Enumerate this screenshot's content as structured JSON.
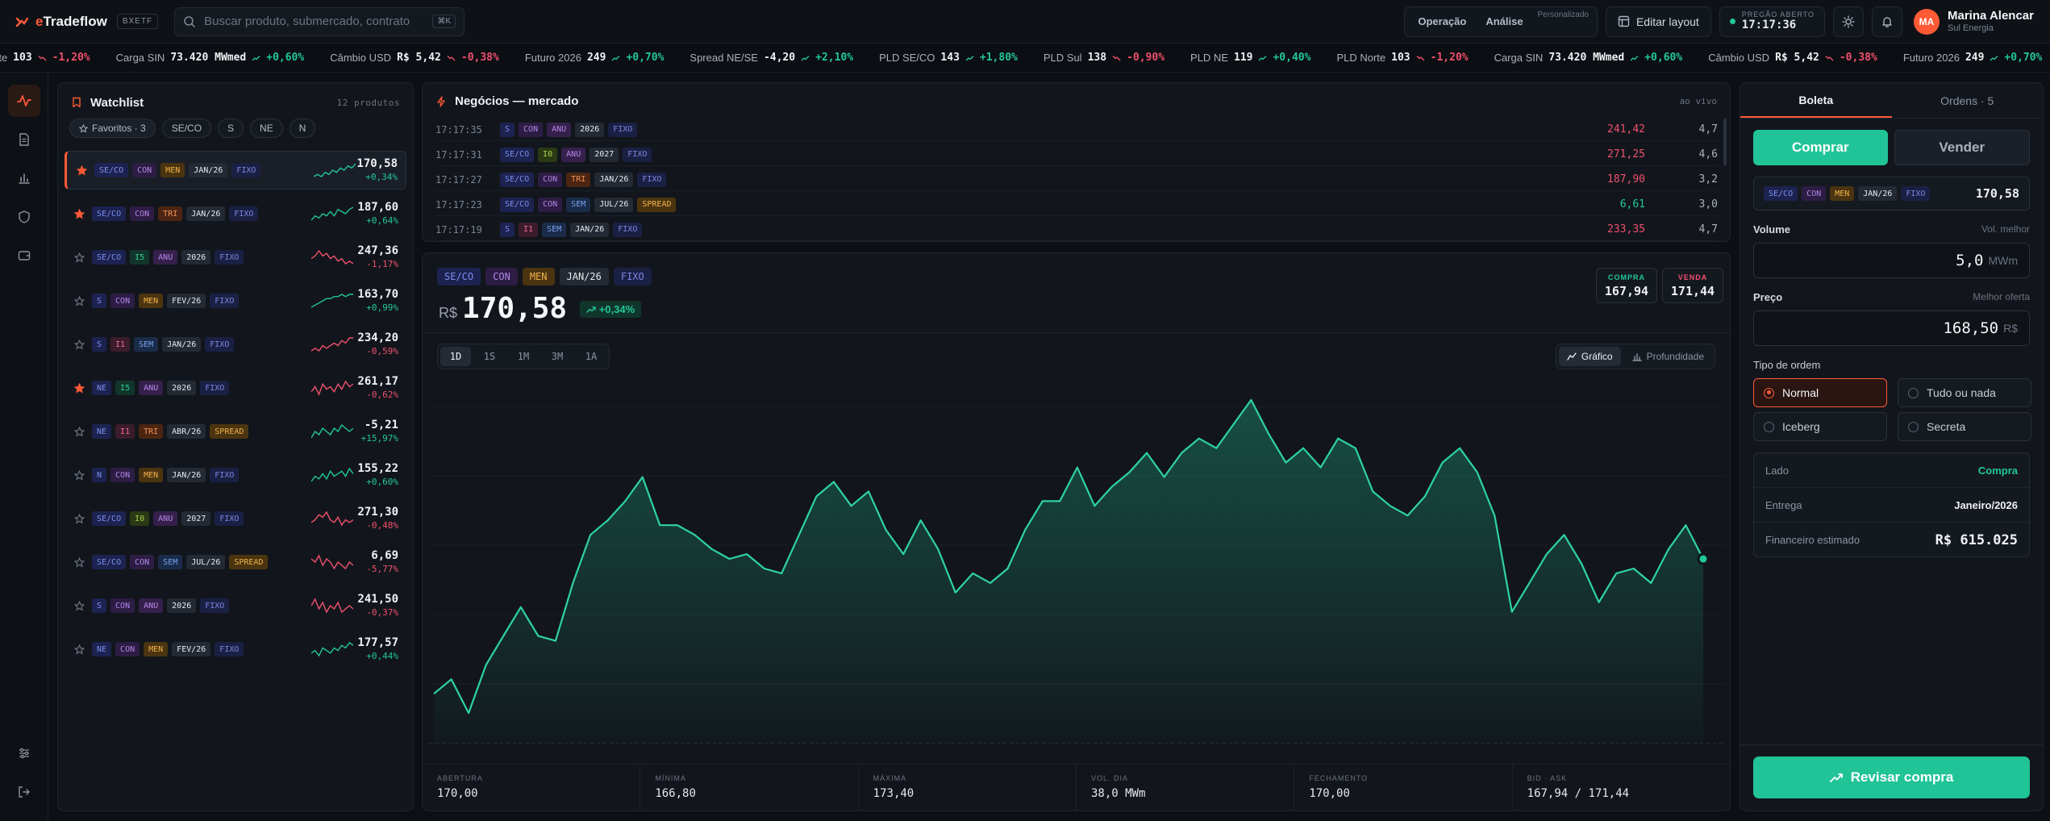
{
  "brand": {
    "name_prefix": "e",
    "name_rest": "Tradeflow",
    "env": "BXETF"
  },
  "search": {
    "placeholder": "Buscar produto, submercado, contrato",
    "shortcut": "⌘K"
  },
  "header": {
    "modes": [
      "Operação",
      "Análise"
    ],
    "custom_label": "Personalizado",
    "edit_layout": "Editar layout",
    "market_status": "PREGÃO ABERTO",
    "clock": "17:17:36",
    "user_initials": "MA",
    "user_name": "Marina Alencar",
    "user_company": "Sul Energia"
  },
  "ticker": [
    {
      "name": "rte",
      "value": "103",
      "change": "-1,20%",
      "dir": "down"
    },
    {
      "name": "Carga SIN",
      "value": "73.420 MWmed",
      "change": "+0,60%",
      "dir": "up"
    },
    {
      "name": "Câmbio USD",
      "value": "R$ 5,42",
      "change": "-0,38%",
      "dir": "down"
    },
    {
      "name": "Futuro 2026",
      "value": "249",
      "change": "+0,70%",
      "dir": "up"
    },
    {
      "name": "Spread NE/SE",
      "value": "-4,20",
      "change": "+2,10%",
      "dir": "up"
    },
    {
      "name": "PLD SE/CO",
      "value": "143",
      "change": "+1,80%",
      "dir": "up"
    },
    {
      "name": "PLD Sul",
      "value": "138",
      "change": "-0,90%",
      "dir": "down"
    },
    {
      "name": "PLD NE",
      "value": "119",
      "change": "+0,40%",
      "dir": "up"
    },
    {
      "name": "PLD Norte",
      "value": "103",
      "change": "-1,20%",
      "dir": "down"
    },
    {
      "name": "Carga SIN",
      "value": "73.420 MWmed",
      "change": "+0,60%",
      "dir": "up"
    },
    {
      "name": "Câmbio USD",
      "value": "R$ 5,42",
      "change": "-0,38%",
      "dir": "down"
    },
    {
      "name": "Futuro 2026",
      "value": "249",
      "change": "+0,70%",
      "dir": "up"
    },
    {
      "name": "Spread NE/SE",
      "value": "",
      "change": "",
      "dir": "up"
    }
  ],
  "watchlist": {
    "title": "Watchlist",
    "count": "12 produtos",
    "filters": [
      "Favoritos · 3",
      "SE/CO",
      "S",
      "NE",
      "N"
    ],
    "rows": [
      {
        "fav": true,
        "tags": [
          [
            "SE/CO",
            "sub"
          ],
          [
            "CON",
            "con"
          ],
          [
            "MEN",
            "men"
          ],
          [
            "JAN/26",
            "date"
          ],
          [
            "FIXO",
            "fixo"
          ]
        ],
        "price": "170,58",
        "change": "+0,34%",
        "dir": "up",
        "spark": [
          3,
          4,
          3,
          5,
          4,
          6,
          5,
          7,
          6,
          8,
          7,
          9
        ]
      },
      {
        "fav": true,
        "tags": [
          [
            "SE/CO",
            "sub"
          ],
          [
            "CON",
            "con"
          ],
          [
            "TRI",
            "tri"
          ],
          [
            "JAN/26",
            "date"
          ],
          [
            "FIXO",
            "fixo"
          ]
        ],
        "price": "187,60",
        "change": "+0,64%",
        "dir": "up",
        "spark": [
          3,
          5,
          4,
          6,
          5,
          7,
          5,
          8,
          7,
          6,
          8,
          9
        ]
      },
      {
        "fav": false,
        "tags": [
          [
            "SE/CO",
            "sub"
          ],
          [
            "I5",
            "i5"
          ],
          [
            "ANU",
            "anu"
          ],
          [
            "2026",
            "date"
          ],
          [
            "FIXO",
            "fixo"
          ]
        ],
        "price": "247,36",
        "change": "-1,17%",
        "dir": "down",
        "spark": [
          5,
          6,
          8,
          6,
          7,
          5,
          6,
          4,
          5,
          3,
          4,
          3
        ]
      },
      {
        "fav": false,
        "tags": [
          [
            "S",
            "sub"
          ],
          [
            "CON",
            "con"
          ],
          [
            "MEN",
            "men"
          ],
          [
            "FEV/26",
            "date"
          ],
          [
            "FIXO",
            "fixo"
          ]
        ],
        "price": "163,70",
        "change": "+0,99%",
        "dir": "up",
        "spark": [
          2,
          3,
          4,
          5,
          6,
          6,
          7,
          7,
          8,
          7,
          8,
          8
        ]
      },
      {
        "fav": false,
        "tags": [
          [
            "S",
            "sub"
          ],
          [
            "I1",
            "i1"
          ],
          [
            "SEM",
            "sem"
          ],
          [
            "JAN/26",
            "date"
          ],
          [
            "FIXO",
            "fixo"
          ]
        ],
        "price": "234,20",
        "change": "-0,59%",
        "dir": "down",
        "spark": [
          3,
          4,
          3,
          5,
          4,
          5,
          6,
          5,
          7,
          6,
          8,
          8
        ]
      },
      {
        "fav": true,
        "tags": [
          [
            "NE",
            "sub"
          ],
          [
            "I5",
            "i5"
          ],
          [
            "ANU",
            "anu"
          ],
          [
            "2026",
            "date"
          ],
          [
            "FIXO",
            "fixo"
          ]
        ],
        "price": "261,17",
        "change": "-0,62%",
        "dir": "down",
        "spark": [
          4,
          6,
          3,
          7,
          5,
          6,
          4,
          7,
          5,
          8,
          6,
          7
        ]
      },
      {
        "fav": false,
        "tags": [
          [
            "NE",
            "sub"
          ],
          [
            "I1",
            "i1"
          ],
          [
            "TRI",
            "tri"
          ],
          [
            "ABR/26",
            "date"
          ],
          [
            "SPREAD",
            "spread"
          ]
        ],
        "price": "-5,21",
        "change": "+15,97%",
        "dir": "up",
        "spark": [
          5,
          7,
          6,
          8,
          7,
          6,
          8,
          7,
          9,
          8,
          7,
          8
        ]
      },
      {
        "fav": false,
        "tags": [
          [
            "N",
            "sub"
          ],
          [
            "CON",
            "con"
          ],
          [
            "MEN",
            "men"
          ],
          [
            "JAN/26",
            "date"
          ],
          [
            "FIXO",
            "fixo"
          ]
        ],
        "price": "155,22",
        "change": "+0,60%",
        "dir": "up",
        "spark": [
          3,
          5,
          4,
          6,
          4,
          7,
          5,
          6,
          7,
          5,
          8,
          6
        ]
      },
      {
        "fav": false,
        "tags": [
          [
            "SE/CO",
            "sub"
          ],
          [
            "I0",
            "i0"
          ],
          [
            "ANU",
            "anu"
          ],
          [
            "2027",
            "date"
          ],
          [
            "FIXO",
            "fixo"
          ]
        ],
        "price": "271,30",
        "change": "-0,48%",
        "dir": "down",
        "spark": [
          4,
          5,
          7,
          6,
          8,
          5,
          4,
          6,
          3,
          5,
          4,
          5
        ]
      },
      {
        "fav": false,
        "tags": [
          [
            "SE/CO",
            "sub"
          ],
          [
            "CON",
            "con"
          ],
          [
            "SEM",
            "sem"
          ],
          [
            "JUL/26",
            "date"
          ],
          [
            "SPREAD",
            "spread"
          ]
        ],
        "price": "6,69",
        "change": "-5,77%",
        "dir": "down",
        "spark": [
          7,
          6,
          8,
          5,
          7,
          6,
          4,
          6,
          5,
          4,
          6,
          5
        ]
      },
      {
        "fav": false,
        "tags": [
          [
            "S",
            "sub"
          ],
          [
            "CON",
            "con"
          ],
          [
            "ANU",
            "anu"
          ],
          [
            "2026",
            "date"
          ],
          [
            "FIXO",
            "fixo"
          ]
        ],
        "price": "241,50",
        "change": "-0,37%",
        "dir": "down",
        "spark": [
          6,
          8,
          5,
          7,
          4,
          6,
          5,
          7,
          4,
          5,
          6,
          5
        ]
      },
      {
        "fav": false,
        "tags": [
          [
            "NE",
            "sub"
          ],
          [
            "CON",
            "con"
          ],
          [
            "MEN",
            "men"
          ],
          [
            "FEV/26",
            "date"
          ],
          [
            "FIXO",
            "fixo"
          ]
        ],
        "price": "177,57",
        "change": "+0,44%",
        "dir": "up",
        "spark": [
          4,
          5,
          3,
          6,
          5,
          4,
          6,
          5,
          7,
          6,
          8,
          7
        ]
      }
    ]
  },
  "trades": {
    "title": "Negócios — mercado",
    "live": "ao vivo",
    "rows": [
      {
        "time": "17:17:35",
        "tags": [
          [
            "S",
            "sub"
          ],
          [
            "CON",
            "con"
          ],
          [
            "ANU",
            "anu"
          ],
          [
            "2026",
            "date"
          ],
          [
            "FIXO",
            "fixo"
          ]
        ],
        "price": "241,42",
        "dir": "down",
        "vol": "4,7"
      },
      {
        "time": "17:17:31",
        "tags": [
          [
            "SE/CO",
            "sub"
          ],
          [
            "I0",
            "i0"
          ],
          [
            "ANU",
            "anu"
          ],
          [
            "2027",
            "date"
          ],
          [
            "FIXO",
            "fixo"
          ]
        ],
        "price": "271,25",
        "dir": "down",
        "vol": "4,6"
      },
      {
        "time": "17:17:27",
        "tags": [
          [
            "SE/CO",
            "sub"
          ],
          [
            "CON",
            "con"
          ],
          [
            "TRI",
            "tri"
          ],
          [
            "JAN/26",
            "date"
          ],
          [
            "FIXO",
            "fixo"
          ]
        ],
        "price": "187,90",
        "dir": "down",
        "vol": "3,2"
      },
      {
        "time": "17:17:23",
        "tags": [
          [
            "SE/CO",
            "sub"
          ],
          [
            "CON",
            "con"
          ],
          [
            "SEM",
            "sem"
          ],
          [
            "JUL/26",
            "date"
          ],
          [
            "SPREAD",
            "spread"
          ]
        ],
        "price": "6,61",
        "dir": "up",
        "vol": "3,0"
      },
      {
        "time": "17:17:19",
        "tags": [
          [
            "S",
            "sub"
          ],
          [
            "I1",
            "i1"
          ],
          [
            "SEM",
            "sem"
          ],
          [
            "JAN/26",
            "date"
          ],
          [
            "FIXO",
            "fixo"
          ]
        ],
        "price": "233,35",
        "dir": "down",
        "vol": "4,7"
      }
    ]
  },
  "instrument": {
    "tags": [
      [
        "SE/CO",
        "sub"
      ],
      [
        "CON",
        "con"
      ],
      [
        "MEN",
        "men"
      ],
      [
        "JAN/26",
        "date"
      ],
      [
        "FIXO",
        "fixo"
      ]
    ],
    "currency": "R$",
    "price": "170,58",
    "change": "+0,34%",
    "buy_label": "COMPRA",
    "buy": "167,94",
    "sell_label": "VENDA",
    "sell": "171,44"
  },
  "chart": {
    "ranges": [
      "1D",
      "1S",
      "1M",
      "3M",
      "1A"
    ],
    "active_range": "1D",
    "views": [
      "Gráfico",
      "Profundidade"
    ],
    "line_color": "#2fd3a3",
    "stats": [
      {
        "label": "ABERTURA",
        "value": "170,00"
      },
      {
        "label": "MÍNIMA",
        "value": "166,80"
      },
      {
        "label": "MÁXIMA",
        "value": "173,40"
      },
      {
        "label": "VOL. DIA",
        "value": "38,0 MWm"
      },
      {
        "label": "FECHAMENTO",
        "value": "170,00"
      },
      {
        "label": "BID · ASK",
        "value": "167,94 / 171,44"
      }
    ]
  },
  "chart_data": {
    "type": "area",
    "ylim": [
      166.4,
      173.6
    ],
    "values": [
      167.3,
      167.6,
      166.9,
      167.9,
      168.5,
      169.1,
      168.5,
      168.4,
      169.6,
      170.6,
      170.9,
      171.3,
      171.8,
      170.8,
      170.8,
      170.6,
      170.3,
      170.1,
      170.2,
      169.9,
      169.8,
      170.6,
      171.4,
      171.7,
      171.2,
      171.5,
      170.7,
      170.2,
      170.9,
      170.3,
      169.4,
      169.8,
      169.6,
      169.9,
      170.7,
      171.3,
      171.3,
      172.0,
      171.2,
      171.6,
      171.9,
      172.3,
      171.8,
      172.3,
      172.6,
      172.4,
      172.9,
      173.4,
      172.7,
      172.1,
      172.4,
      172.0,
      172.6,
      172.4,
      171.5,
      171.2,
      171.0,
      171.4,
      172.1,
      172.4,
      171.9,
      171.0,
      169.0,
      169.6,
      170.2,
      170.6,
      170.0,
      169.2,
      169.8,
      169.9,
      169.6,
      170.3,
      170.8,
      170.1
    ]
  },
  "ticket": {
    "tabs": [
      "Boleta",
      "Ordens · 5"
    ],
    "buy": "Comprar",
    "sell": "Vender",
    "tags": [
      [
        "SE/CO",
        "sub"
      ],
      [
        "CON",
        "con"
      ],
      [
        "MEN",
        "men"
      ],
      [
        "JAN/26",
        "date"
      ],
      [
        "FIXO",
        "fixo"
      ]
    ],
    "price": "170,58",
    "volume_label": "Volume",
    "volume_hint": "Vol. melhor",
    "volume": "5,0",
    "volume_unit": "MWm",
    "price_label": "Preço",
    "price_hint": "Melhor oferta",
    "order_price": "168,50",
    "price_unit": "R$",
    "order_type_label": "Tipo de ordem",
    "order_types": [
      "Normal",
      "Tudo ou nada",
      "Iceberg",
      "Secreta"
    ],
    "summary": [
      {
        "k": "Lado",
        "v": "Compra",
        "accent": true
      },
      {
        "k": "Entrega",
        "v": "Janeiro/2026",
        "accent": false
      },
      {
        "k": "Financeiro estimado",
        "v": "R$ 615.025",
        "accent": false
      }
    ],
    "review": "Revisar compra"
  },
  "colors": {
    "accent": "#ff5a36",
    "up": "#22c79a",
    "down": "#f0506e"
  }
}
